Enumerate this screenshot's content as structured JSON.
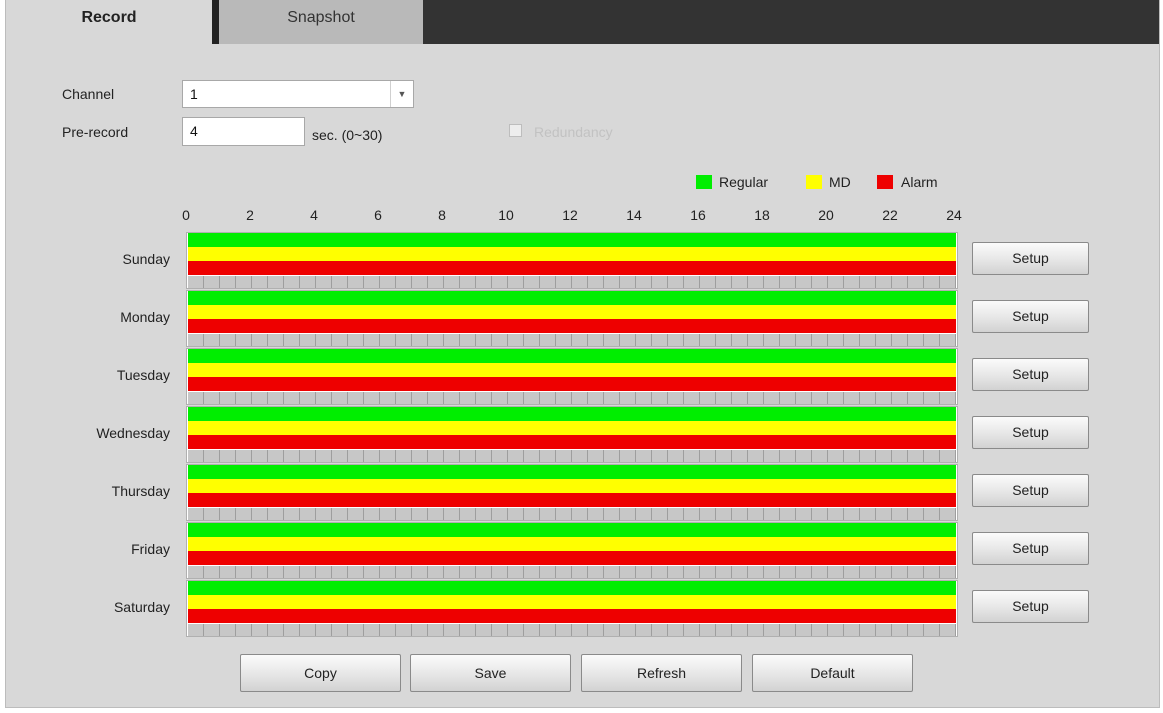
{
  "tabs": [
    {
      "label": "Record",
      "active": true
    },
    {
      "label": "Snapshot",
      "active": false
    }
  ],
  "form": {
    "channel_label": "Channel",
    "channel_value": "1",
    "prerecord_label": "Pre-record",
    "prerecord_value": "4",
    "prerecord_unit": "sec. (0~30)",
    "redundancy_label": "Redundancy",
    "redundancy_checked": false,
    "redundancy_enabled": false
  },
  "legend": [
    {
      "label": "Regular",
      "color": "#00ee00"
    },
    {
      "label": "MD",
      "color": "#ffff00"
    },
    {
      "label": "Alarm",
      "color": "#ee0000"
    }
  ],
  "timeline_ticks": [
    "0",
    "2",
    "4",
    "6",
    "8",
    "10",
    "12",
    "14",
    "16",
    "18",
    "20",
    "22",
    "24"
  ],
  "schedule": [
    {
      "day": "Sunday",
      "regular": [
        0,
        24
      ],
      "md": [
        0,
        24
      ],
      "alarm": [
        0,
        24
      ],
      "setup_label": "Setup"
    },
    {
      "day": "Monday",
      "regular": [
        0,
        24
      ],
      "md": [
        0,
        24
      ],
      "alarm": [
        0,
        24
      ],
      "setup_label": "Setup"
    },
    {
      "day": "Tuesday",
      "regular": [
        0,
        24
      ],
      "md": [
        0,
        24
      ],
      "alarm": [
        0,
        24
      ],
      "setup_label": "Setup"
    },
    {
      "day": "Wednesday",
      "regular": [
        0,
        24
      ],
      "md": [
        0,
        24
      ],
      "alarm": [
        0,
        24
      ],
      "setup_label": "Setup"
    },
    {
      "day": "Thursday",
      "regular": [
        0,
        24
      ],
      "md": [
        0,
        24
      ],
      "alarm": [
        0,
        24
      ],
      "setup_label": "Setup"
    },
    {
      "day": "Friday",
      "regular": [
        0,
        24
      ],
      "md": [
        0,
        24
      ],
      "alarm": [
        0,
        24
      ],
      "setup_label": "Setup"
    },
    {
      "day": "Saturday",
      "regular": [
        0,
        24
      ],
      "md": [
        0,
        24
      ],
      "alarm": [
        0,
        24
      ],
      "setup_label": "Setup"
    }
  ],
  "actions": {
    "copy_label": "Copy",
    "save_label": "Save",
    "refresh_label": "Refresh",
    "default_label": "Default"
  },
  "icons": {
    "dropdown": "chevron-down-icon"
  }
}
